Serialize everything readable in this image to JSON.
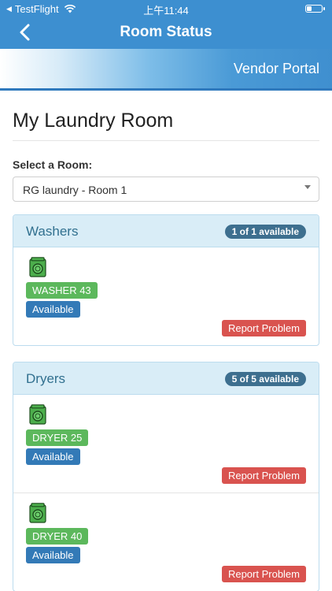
{
  "status_bar": {
    "app": "TestFlight",
    "time": "上午11:44"
  },
  "nav": {
    "title": "Room Status"
  },
  "portal": {
    "label": "Vendor Portal"
  },
  "page": {
    "title": "My Laundry Room",
    "select_label": "Select a Room:",
    "selected_room": "RG laundry - Room 1"
  },
  "washers": {
    "title": "Washers",
    "count": "1 of 1 available",
    "machines": [
      {
        "name": "WASHER 43",
        "status": "Available",
        "report": "Report Problem"
      }
    ]
  },
  "dryers": {
    "title": "Dryers",
    "count": "5 of 5 available",
    "machines": [
      {
        "name": "DRYER 25",
        "status": "Available",
        "report": "Report Problem"
      },
      {
        "name": "DRYER 40",
        "status": "Available",
        "report": "Report Problem"
      }
    ]
  },
  "colors": {
    "nav_blue": "#3d8fd0",
    "name_green": "#5cb85c",
    "status_blue": "#337ab7",
    "report_red": "#d9534f",
    "panel_bg": "#d9edf7"
  }
}
